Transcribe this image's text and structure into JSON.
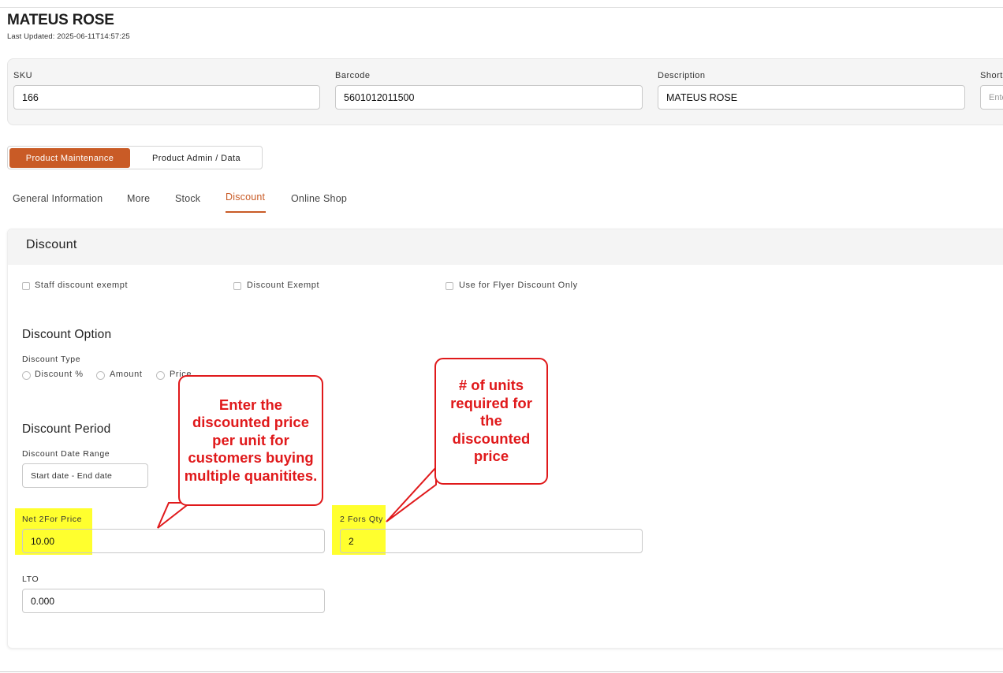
{
  "product": {
    "title": "MATEUS ROSE",
    "last_updated": "Last Updated: 2025-06-11T14:57:25"
  },
  "identity": {
    "sku_label": "SKU",
    "sku_value": "166",
    "barcode_label": "Barcode",
    "barcode_value": "5601012011500",
    "description_label": "Description",
    "description_value": "MATEUS ROSE",
    "short_label": "Short",
    "short_placeholder": "Ente"
  },
  "segments": {
    "active": "Product Maintenance",
    "other": "Product Admin / Data"
  },
  "tabs": [
    "General Information",
    "More",
    "Stock",
    "Discount",
    "Online Shop"
  ],
  "discount": {
    "header": "Discount",
    "checkboxes": [
      "Staff discount exempt",
      "Discount Exempt",
      "Use for Flyer Discount Only"
    ],
    "option_title": "Discount Option",
    "type_label": "Discount Type",
    "type_options": [
      "Discount %",
      "Amount",
      "Price"
    ],
    "period_title": "Discount Period",
    "date_range_label": "Discount Date Range",
    "date_range_placeholder": "Start date - End date",
    "net_price_label": "Net 2For Price",
    "net_price_value": "10.00",
    "qty_label": "2 Fors Qty",
    "qty_value": "2",
    "lto_label": "LTO",
    "lto_value": "0.000"
  },
  "annotations": {
    "price_note": "Enter the discounted price per unit for customers buying multiple quanitites.",
    "qty_note": "# of units required for the discounted price"
  },
  "colors": {
    "accent": "#c95b26",
    "highlight": "#ffff2e",
    "annotation": "#e0191b"
  }
}
